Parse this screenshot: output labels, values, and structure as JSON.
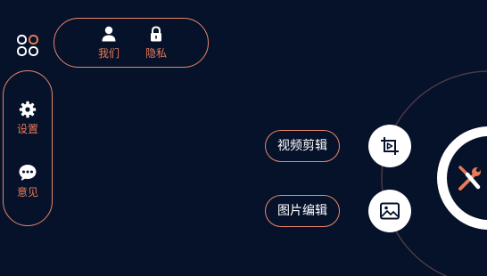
{
  "top_menu": {
    "items": [
      {
        "label": "我们",
        "icon": "user-icon"
      },
      {
        "label": "隐私",
        "icon": "lock-icon"
      }
    ]
  },
  "side_menu": {
    "items": [
      {
        "label": "设置",
        "icon": "gear-icon"
      },
      {
        "label": "意见",
        "icon": "chat-bubble-icon"
      }
    ]
  },
  "actions": {
    "video_edit_label": "视频剪辑",
    "image_edit_label": "图片编辑"
  },
  "colors": {
    "background": "#06112a",
    "accent": "#e87a56",
    "white": "#ffffff"
  }
}
